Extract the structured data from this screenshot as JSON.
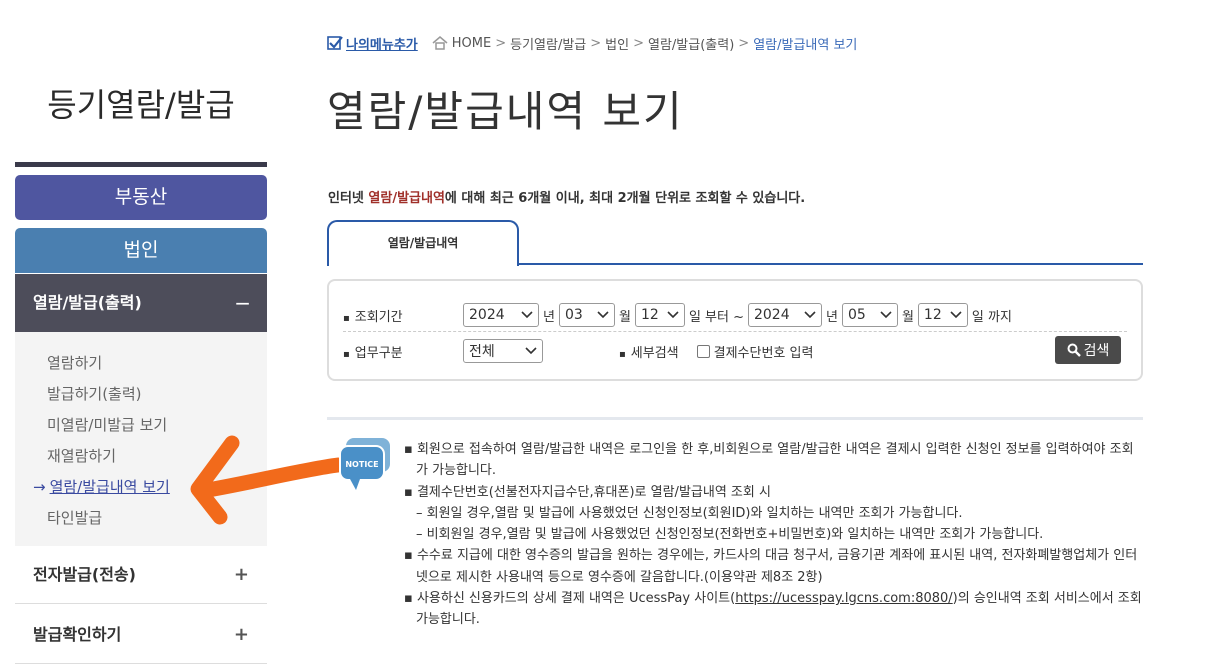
{
  "sidebar": {
    "title": "등기열람/발급",
    "real_estate": "부동산",
    "corporation": "법인",
    "active_section": {
      "label": "열람/발급(출력)",
      "toggle": "−"
    },
    "submenu": [
      "열람하기",
      "발급하기(출력)",
      "미열람/미발급 보기",
      "재열람하기",
      "열람/발급내역 보기",
      "타인발급"
    ],
    "active_arrow": "→",
    "sections": [
      {
        "label": "전자발급(전송)",
        "toggle": "+"
      },
      {
        "label": "발급확인하기",
        "toggle": "+"
      }
    ]
  },
  "breadcrumb": {
    "my_menu": "나의메뉴추가",
    "items": [
      "HOME",
      "등기열람/발급",
      "법인",
      "열람/발급(출력)"
    ],
    "current": "열람/발급내역 보기",
    "sep": ">"
  },
  "page": {
    "title": "열람/발급내역 보기",
    "notice_pre": "인터넷 ",
    "notice_hl": "열람/발급내역",
    "notice_post": "에 대해 최근 6개월 이내, 최대 2개월 단위로 조회할 수 있습니다."
  },
  "tab": {
    "label": "열람/발급내역"
  },
  "search": {
    "period_label": "조회기간",
    "from_year": "2024",
    "from_month": "03",
    "from_day": "12",
    "to_year": "2024",
    "to_month": "05",
    "to_day": "12",
    "unit_year": "년",
    "unit_month": "월",
    "unit_from": "일 부터 ~",
    "unit_to": "일 까지",
    "task_label": "업무구분",
    "task_value": "전체",
    "detail_label": "세부검색",
    "checkbox_label": "결제수단번호 입력",
    "search_button": "검색"
  },
  "notes": {
    "icon_text": "NOTICE",
    "n1": "회원으로 접속하여 열람/발급한 내역은 로그인을 한 후,비회원으로 열람/발급한 내역은 결제시 입력한 신청인 정보를 입력하여야 조회가 가능합니다.",
    "n2": "결제수단번호(선불전자지급수단,휴대폰)로 열람/발급내역 조회 시",
    "n2a": "회원일 경우,열람 및 발급에 사용했었던 신청인정보(회원ID)와 일치하는 내역만 조회가 가능합니다.",
    "n2b": "비회원일 경우,열람 및 발급에 사용했었던 신청인정보(전화번호+비밀번호)와 일치하는 내역만 조회가 가능합니다.",
    "n3": "수수료 지급에 대한 영수증의 발급을 원하는 경우에는, 카드사의 대금 청구서, 금융기관 계좌에 표시된 내역, 전자화폐발행업체가 인터넷으로 제시한 사용내역 등으로 영수증에 갈음합니다.(이용약관 제8조 2항)",
    "n4_pre": "사용하신 신용카드의 상세 결제 내역은 UcessPay 사이트(",
    "n4_link": "https://ucesspay.lgcns.com:8080/",
    "n4_post": ")의 승인내역 조회 서비스에서 조회 가능합니다."
  },
  "colors": {
    "primary_blue": "#2a5aa8",
    "real_estate_btn": "#4f56a0",
    "corp_btn": "#4a7fb0",
    "active_section": "#4d4d5a",
    "highlight_red": "#a0302a",
    "annotation_orange": "#f26a1b"
  }
}
